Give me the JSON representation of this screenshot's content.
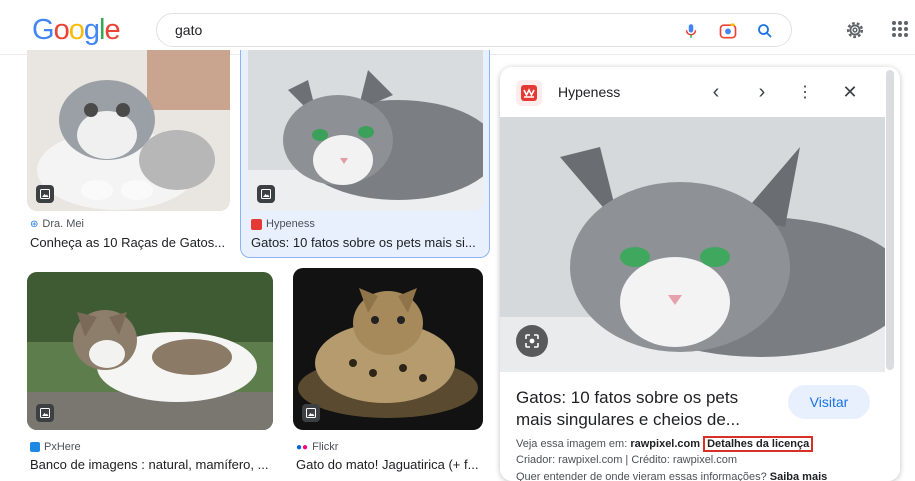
{
  "header": {
    "logo_letters": [
      {
        "ch": "G",
        "color": "#4285F4"
      },
      {
        "ch": "o",
        "color": "#EA4335"
      },
      {
        "ch": "o",
        "color": "#FBBC05"
      },
      {
        "ch": "g",
        "color": "#4285F4"
      },
      {
        "ch": "l",
        "color": "#34A853"
      },
      {
        "ch": "e",
        "color": "#EA4335"
      }
    ],
    "search_query": "gato",
    "icons": [
      "mic-icon",
      "lens-icon",
      "search-icon",
      "settings-icon",
      "apps-icon"
    ]
  },
  "results": [
    {
      "source": "Dra. Mei",
      "title": "Conheça as 10 Raças de Gatos...",
      "source_icon": "paw-icon"
    },
    {
      "source": "Hypeness",
      "title": "Gatos: 10 fatos sobre os pets mais si...",
      "source_icon": "hypeness-icon",
      "selected": true
    },
    {
      "source": "PxHere",
      "title": "Banco de imagens : natural, mamífero, ...",
      "source_icon": "pxhere-icon"
    },
    {
      "source": "Flickr",
      "title": "Gato do mato! Jaguatirica (+ f...",
      "source_icon": "flickr-icon"
    }
  ],
  "panel": {
    "site_name": "Hypeness",
    "title": "Gatos: 10 fatos sobre os pets mais singulares e cheios de...",
    "visit_label": "Visitar",
    "view_on_prefix": "Veja essa imagem em:",
    "view_on_site": "rawpixel.com",
    "license_label": "Detalhes da licença",
    "credits": "Criador: rawpixel.com | Crédito: rawpixel.com",
    "more_prefix": "Quer entender de onde vieram essas informações?",
    "more_link": "Saiba mais"
  },
  "colors": {
    "accent": "#1a73e8",
    "selected_bg": "#e8f0fe",
    "license_border": "#d93025"
  }
}
